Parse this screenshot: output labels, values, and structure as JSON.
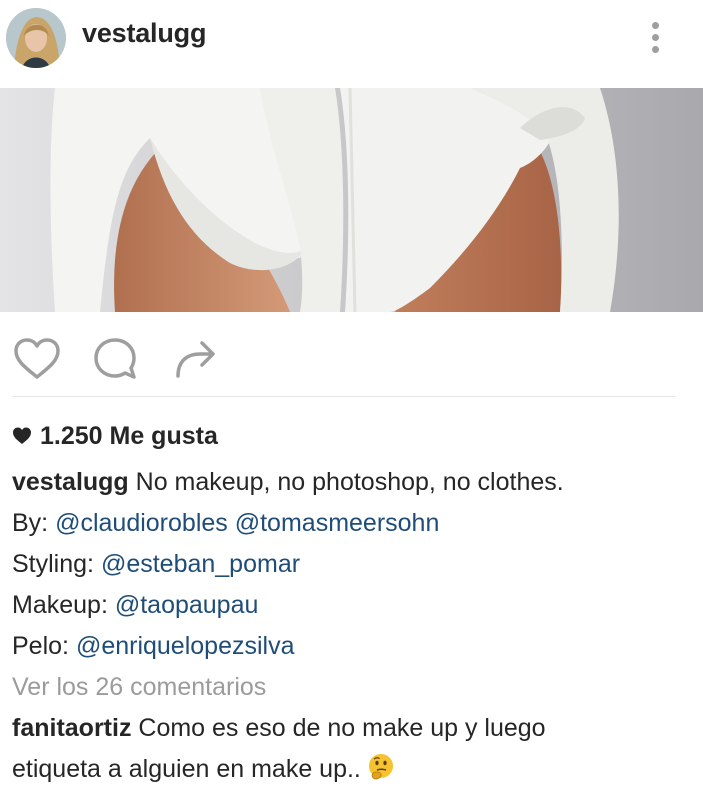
{
  "post": {
    "username": "vestalugg",
    "likes_label": "1.250 Me gusta"
  },
  "caption": {
    "author": "vestalugg",
    "text": " No makeup, no photoshop, no clothes.",
    "credits": [
      {
        "label": "By: ",
        "handles": [
          "@claudiorobles",
          "@tomasmeersohn"
        ]
      },
      {
        "label": "Styling: ",
        "handles": [
          "@esteban_pomar"
        ]
      },
      {
        "label": "Makeup: ",
        "handles": [
          "@taopaupau"
        ]
      },
      {
        "label": "Pelo: ",
        "handles": [
          "@enriquelopezsilva"
        ]
      }
    ]
  },
  "comments": {
    "view_all_label": "Ver los 26 comentarios",
    "items": [
      {
        "author": "fanitaortiz",
        "text_line1": " Como es eso de no make up y luego",
        "text_line2": "etiqueta a alguien en make up.."
      }
    ]
  },
  "icons": {
    "more": "more-vertical-icon",
    "like": "heart-outline-icon",
    "comment": "comment-bubble-icon",
    "share": "share-arrow-icon",
    "likes_heart": "heart-filled-icon",
    "emoji": "thinking-face-emoji"
  },
  "colors": {
    "text": "#262626",
    "link": "#1f4d78",
    "muted": "#9b9b9b",
    "icon": "#9e9e9e"
  }
}
